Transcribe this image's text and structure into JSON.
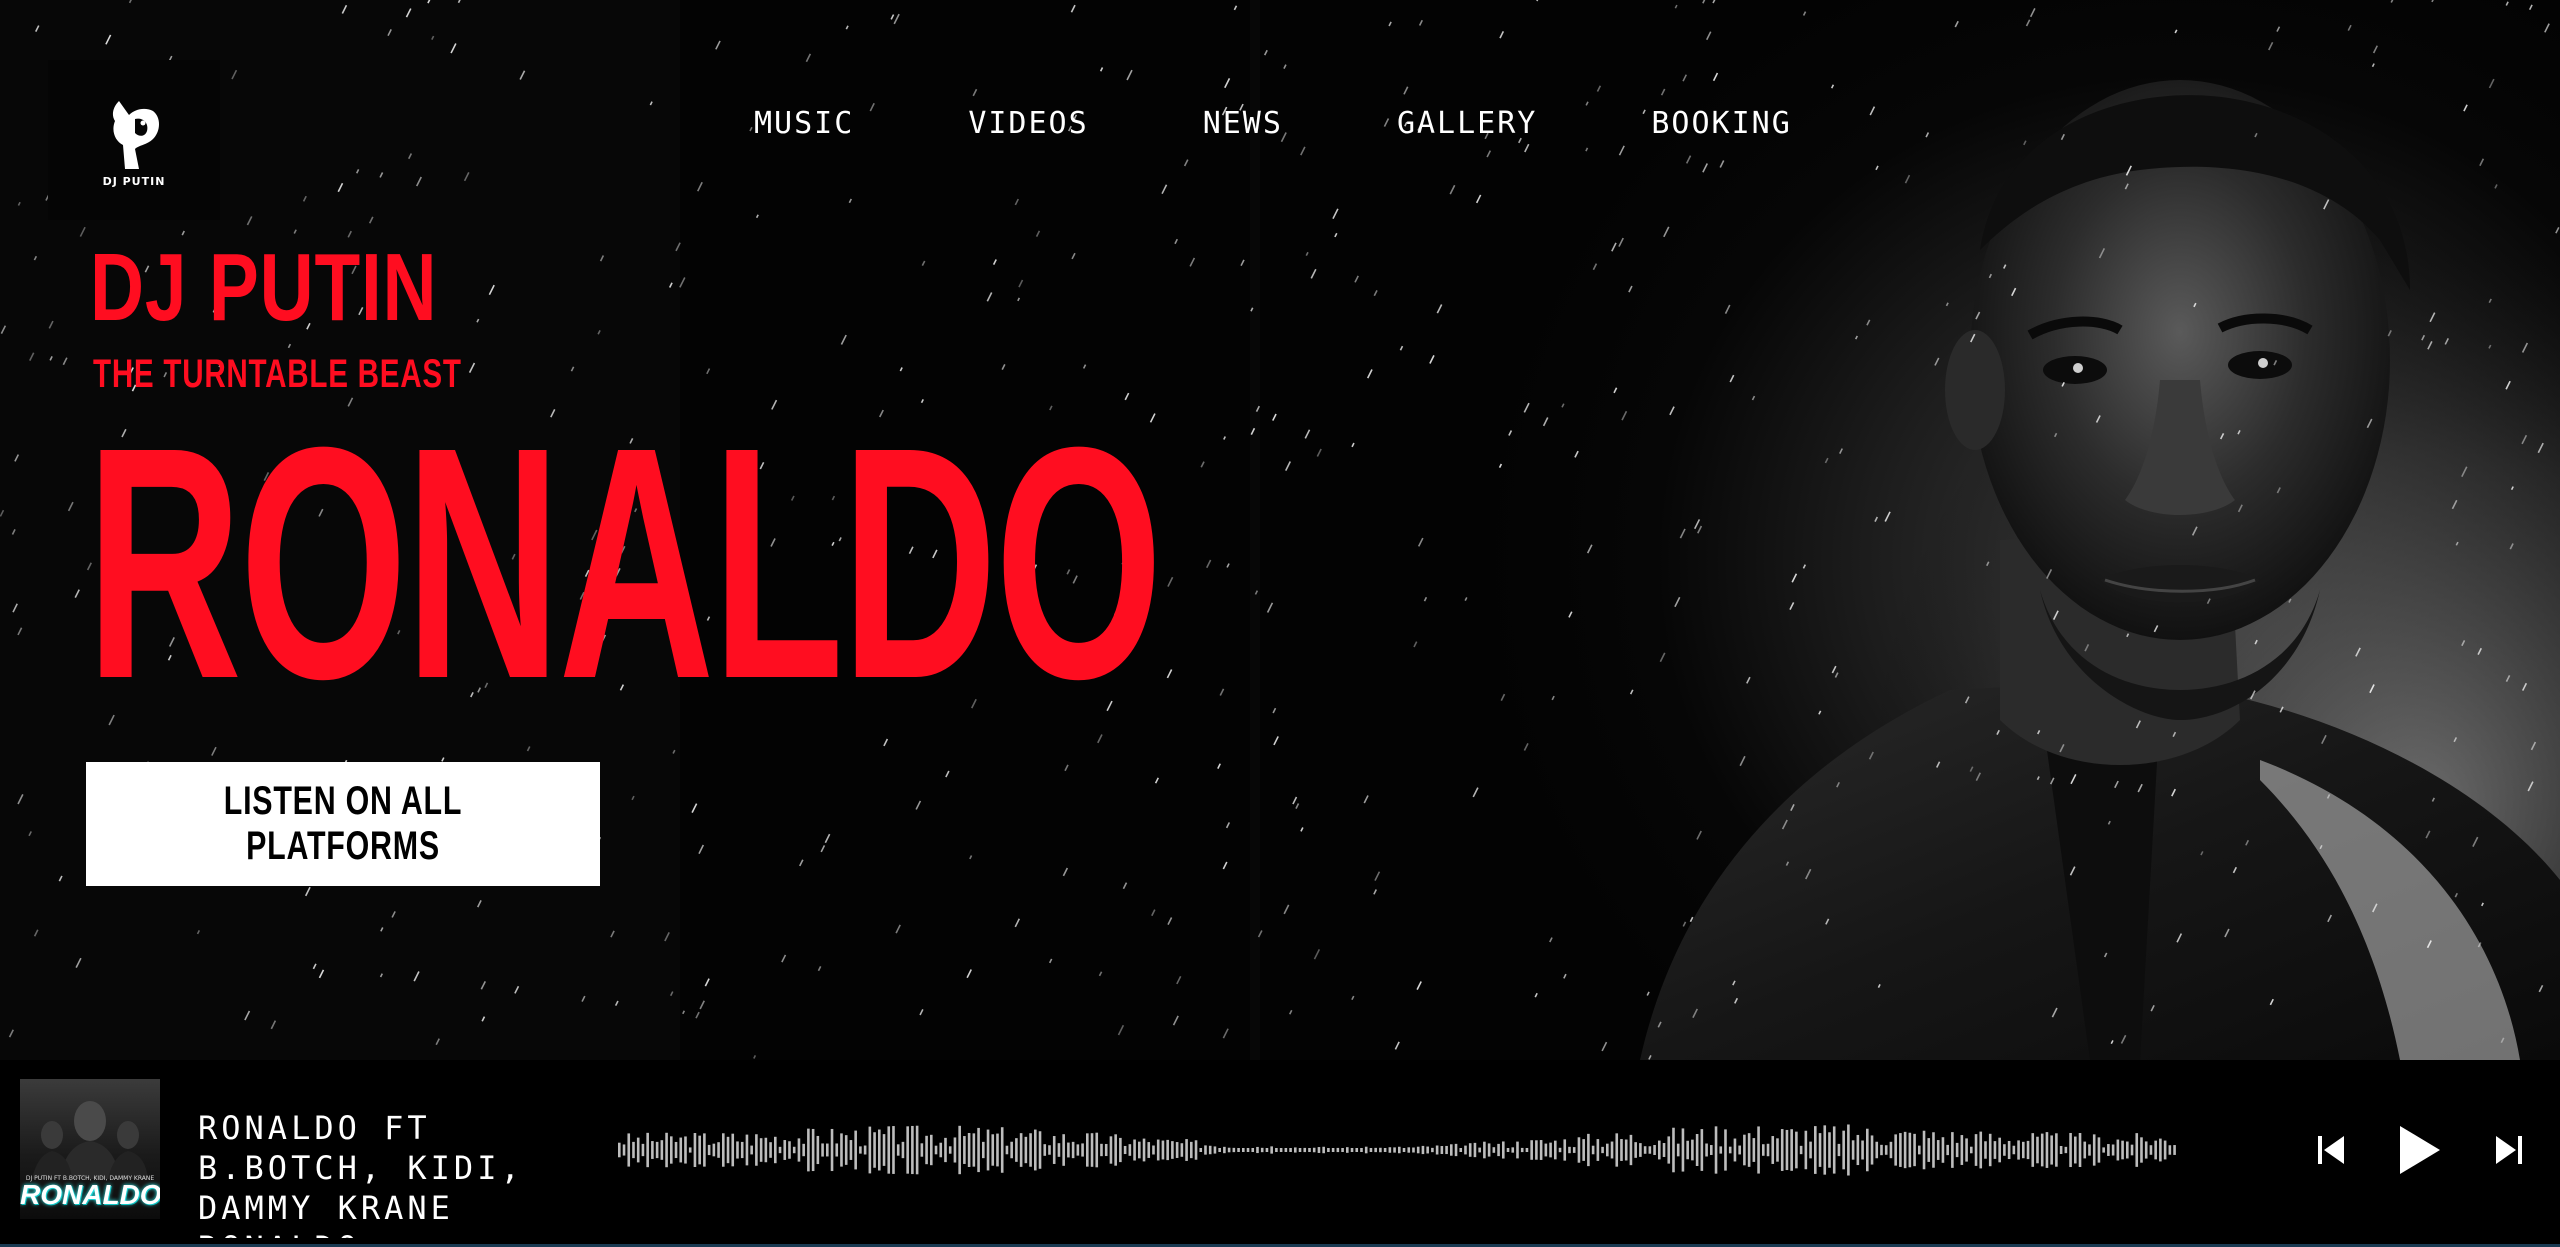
{
  "brand": {
    "logo_text": "DJ PUTIN"
  },
  "nav": {
    "items": [
      "MUSIC",
      "VIDEOS",
      "NEWS",
      "GALLERY",
      "BOOKING"
    ]
  },
  "hero": {
    "artist": "DJ PUTIN",
    "tagline": "THE TURNTABLE BEAST",
    "headline": "RONALDO",
    "cta_label": "LISTEN ON ALL PLATFORMS"
  },
  "player": {
    "cover_title": "RONALDO",
    "cover_credits": "DJ PUTIN FT B.BOTCH, KIDI, DAMMY KRANE",
    "track_title": "RONALDO FT B.BOTCH, KIDI, DAMMY KRANE",
    "track_sub": "RONALDO",
    "controls": [
      "previous-icon",
      "play-icon",
      "next-icon"
    ]
  },
  "colors": {
    "accent_red": "#ff0d20",
    "background": "#000000",
    "button_bg": "#ffffff"
  }
}
